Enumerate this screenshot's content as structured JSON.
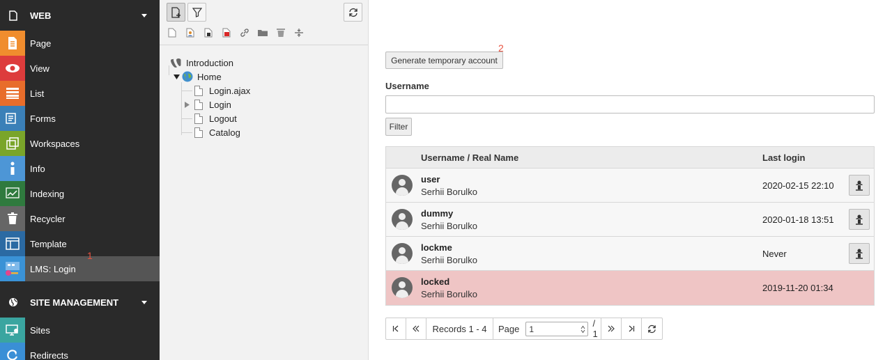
{
  "module_menu": {
    "groups": [
      {
        "label": "WEB",
        "items": [
          {
            "label": "Page",
            "icon": "page-module-icon",
            "color": "#f08d2e"
          },
          {
            "label": "View",
            "icon": "eye-icon",
            "color": "#dd3c3c"
          },
          {
            "label": "List",
            "icon": "list-icon",
            "color": "#e86d2b"
          },
          {
            "label": "Forms",
            "icon": "forms-icon",
            "color": "#3b80b8"
          },
          {
            "label": "Workspaces",
            "icon": "workspaces-icon",
            "color": "#7aa52a"
          },
          {
            "label": "Info",
            "icon": "info-icon",
            "color": "#4d96d6"
          },
          {
            "label": "Indexing",
            "icon": "indexing-chart-icon",
            "color": "#2f7a3e"
          },
          {
            "label": "Recycler",
            "icon": "trash-icon",
            "color": "#666666"
          },
          {
            "label": "Template",
            "icon": "template-icon",
            "color": "#2b6aa3"
          },
          {
            "label": "LMS: Login",
            "icon": "lms-login-icon",
            "color": "#3a92d6"
          }
        ]
      },
      {
        "label": "SITE MANAGEMENT",
        "items": [
          {
            "label": "Sites",
            "icon": "sites-icon",
            "color": "#3aa5a0"
          },
          {
            "label": "Redirects",
            "icon": "redirect-icon",
            "color": "#3a8fd6"
          }
        ]
      }
    ],
    "badge": "1"
  },
  "page_tree": {
    "root": "Introduction",
    "home": "Home",
    "pages": [
      "Login.ajax",
      "Login",
      "Logout",
      "Catalog"
    ]
  },
  "main": {
    "badge": "2",
    "generate_button": "Generate temporary account",
    "username_label": "Username",
    "username_value": "",
    "filter_button": "Filter",
    "table": {
      "col_username": "Username / Real Name",
      "col_last_login": "Last login",
      "rows": [
        {
          "username": "user",
          "real_name": "Serhii Borulko",
          "last_login": "2020-02-15 22:10"
        },
        {
          "username": "dummy",
          "real_name": "Serhii Borulko",
          "last_login": "2020-01-18 13:51"
        },
        {
          "username": "lockme",
          "real_name": "Serhii Borulko",
          "last_login": "Never"
        },
        {
          "username": "locked",
          "real_name": "Serhii Borulko",
          "last_login": "2019-11-20 01:34"
        }
      ]
    },
    "pagination": {
      "records": "Records 1 - 4",
      "page_label": "Page",
      "page_value": "1",
      "total": "/ 1"
    }
  }
}
